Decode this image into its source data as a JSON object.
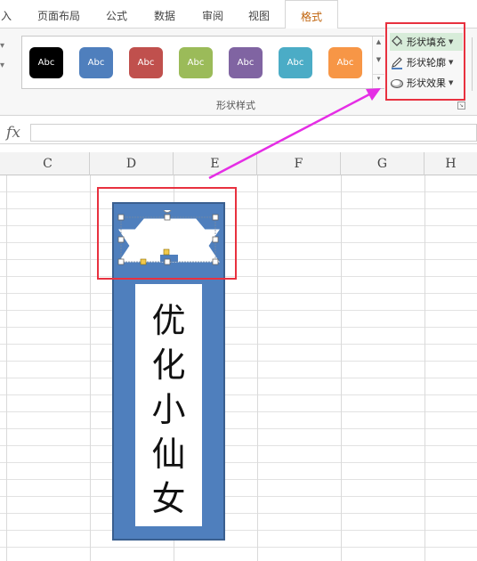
{
  "tabs": [
    {
      "label": "入",
      "active": false
    },
    {
      "label": "页面布局",
      "active": false
    },
    {
      "label": "公式",
      "active": false
    },
    {
      "label": "数据",
      "active": false
    },
    {
      "label": "审阅",
      "active": false
    },
    {
      "label": "视图",
      "active": false
    },
    {
      "label": "格式",
      "active": true
    }
  ],
  "gallery": {
    "group_label": "形状样式",
    "styles": [
      {
        "label": "Abc",
        "fill": "#000000"
      },
      {
        "label": "Abc",
        "fill": "#4f7fbd"
      },
      {
        "label": "Abc",
        "fill": "#c0504d"
      },
      {
        "label": "Abc",
        "fill": "#9bbb59"
      },
      {
        "label": "Abc",
        "fill": "#8064a2"
      },
      {
        "label": "Abc",
        "fill": "#4bacc6"
      },
      {
        "label": "Abc",
        "fill": "#f79646"
      }
    ]
  },
  "commands": {
    "fill": "形状填充",
    "outline": "形状轮廓",
    "effects": "形状效果"
  },
  "formula_bar": {
    "fx": "fx",
    "value": ""
  },
  "columns": [
    "C",
    "D",
    "E",
    "F",
    "G",
    "H"
  ],
  "bookmark": {
    "text_chars": [
      "优",
      "化",
      "小",
      "仙",
      "女"
    ]
  },
  "colors": {
    "highlight": "#e8313f",
    "arrow": "#e52ee5",
    "shape_fill": "#4f7fbd",
    "accent_tab": "#c0630b"
  }
}
